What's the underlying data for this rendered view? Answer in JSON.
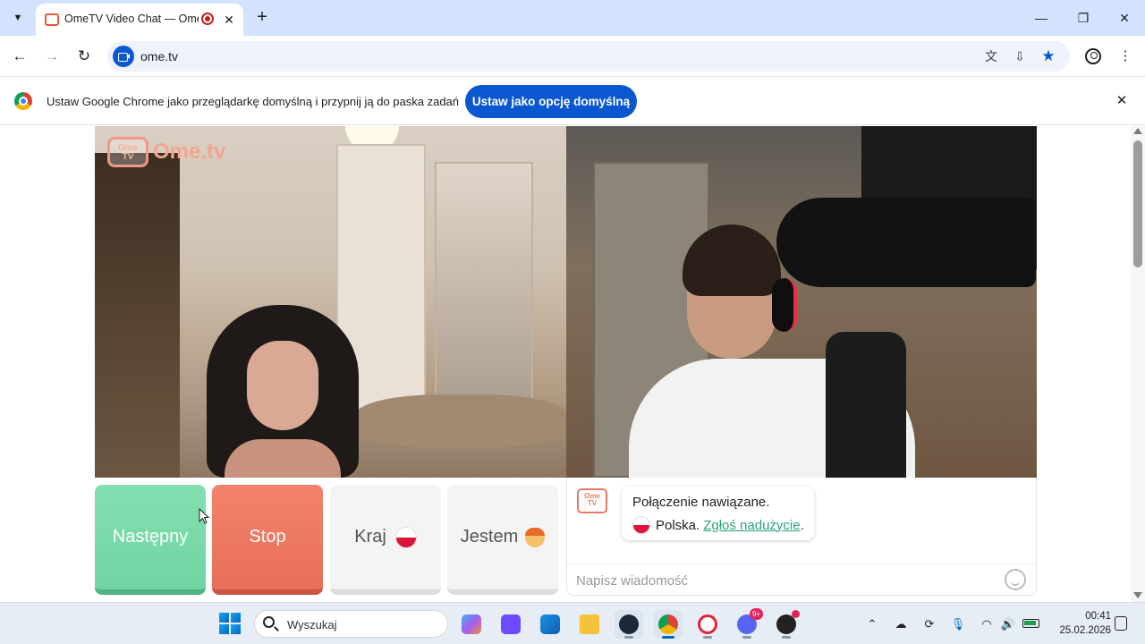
{
  "browser": {
    "tab": {
      "title": "OmeTV Video Chat — Omegle alternative"
    },
    "address": {
      "url": "ome.tv"
    },
    "infobar": {
      "message": "Ustaw Google Chrome jako przeglądarkę domyślną i przypnij ją do paska zadań",
      "button": "Ustaw jako opcję domyślną"
    }
  },
  "logo": {
    "tv_text": "Ome TV",
    "brand": "Ome.tv"
  },
  "controls": {
    "next": "Następny",
    "stop": "Stop",
    "country": "Kraj",
    "gender": "Jestem"
  },
  "chat": {
    "logo_text": "Ome TV",
    "status": "Połączenie nawiązane.",
    "country": "Polska.",
    "report": "Zgłoś nadużycie",
    "trailing": ".",
    "input_placeholder": "Napisz wiadomość"
  },
  "taskbar": {
    "search_placeholder": "Wyszukaj",
    "discord_badge": "9+",
    "time": "00:41",
    "date": "25.02.2026"
  },
  "colors": {
    "next_button": "#70d4a2",
    "stop_button": "#e86f58",
    "brand_accent": "#f4a590",
    "link_green": "#2aa37a",
    "chrome_blue": "#0b57d0"
  }
}
